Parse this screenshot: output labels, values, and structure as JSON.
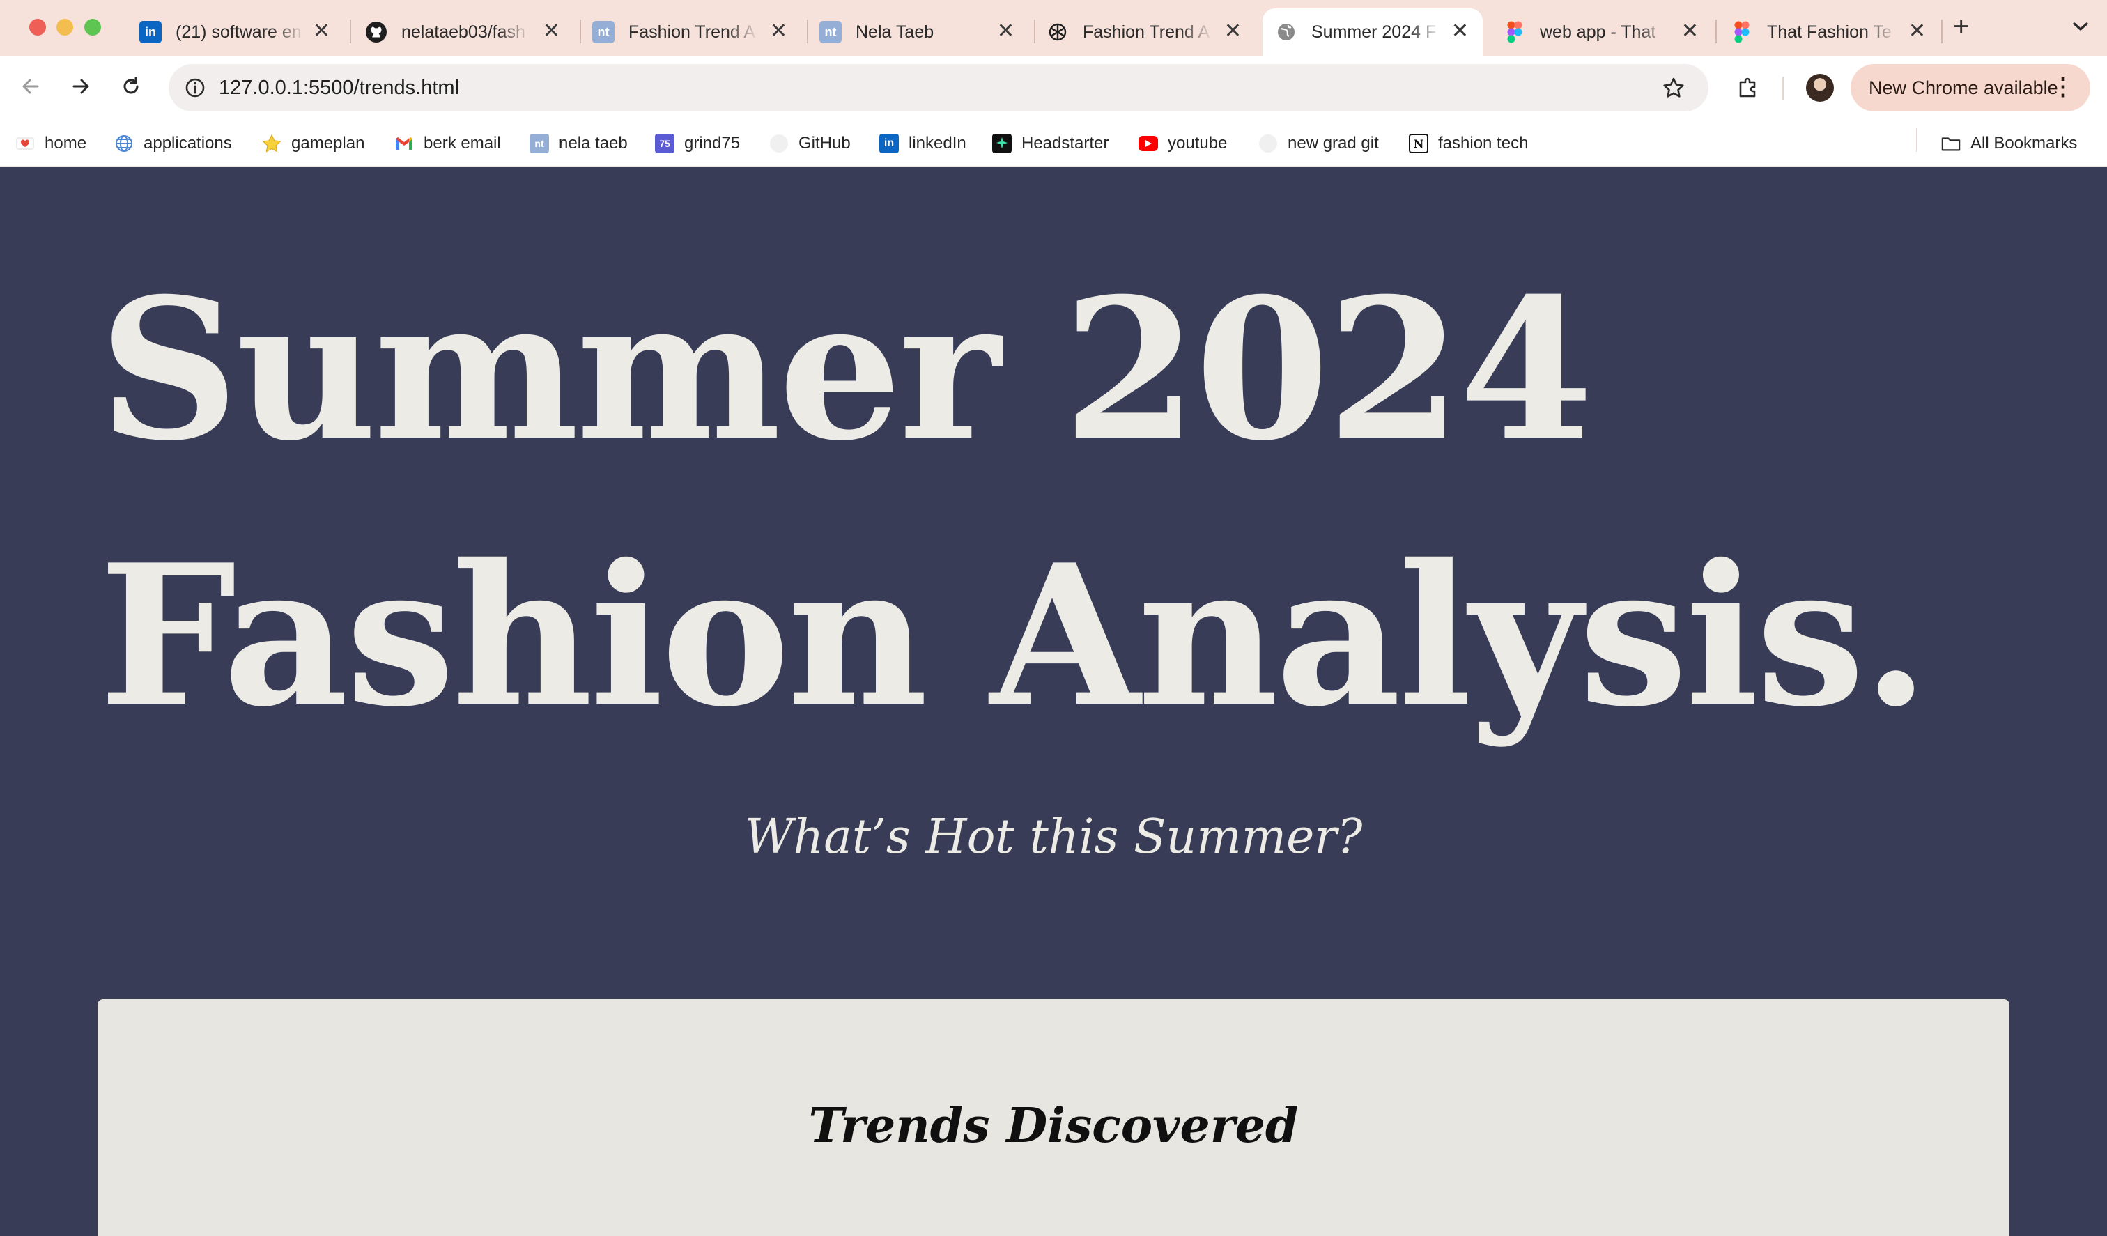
{
  "browser": {
    "tabs": [
      {
        "title": "(21) software en",
        "favicon": "linkedin-icon",
        "active": false
      },
      {
        "title": "nelataeb03/fash",
        "favicon": "github-icon",
        "active": false
      },
      {
        "title": "Fashion Trend A",
        "favicon": "nt-icon",
        "active": false
      },
      {
        "title": "Nela Taeb",
        "favicon": "nt-icon",
        "active": false
      },
      {
        "title": "Fashion Trend A",
        "favicon": "chatgpt-icon",
        "active": false
      },
      {
        "title": "Summer 2024 F",
        "favicon": "globe-icon",
        "active": true
      },
      {
        "title": "web app - That",
        "favicon": "figma-icon",
        "active": false
      },
      {
        "title": "That Fashion Te",
        "favicon": "figma-icon",
        "active": false
      }
    ],
    "favicon_text": {
      "nt": "nt"
    },
    "close_glyph": "✕",
    "new_tab_glyph": "+",
    "url": "127.0.0.1:5500/trends.html",
    "update_label": "New Chrome available",
    "bookmarks": [
      {
        "label": "home",
        "icon": "heart-mail-icon"
      },
      {
        "label": "applications",
        "icon": "globe-icon"
      },
      {
        "label": "gameplan",
        "icon": "star-icon"
      },
      {
        "label": "berk email",
        "icon": "gmail-icon"
      },
      {
        "label": "nela taeb",
        "icon": "nt-icon"
      },
      {
        "label": "grind75",
        "icon": "grind75-icon",
        "icon_text": "75"
      },
      {
        "label": "GitHub",
        "icon": "github-icon"
      },
      {
        "label": "linkedIn",
        "icon": "linkedin-icon"
      },
      {
        "label": "Headstarter",
        "icon": "headstarter-icon"
      },
      {
        "label": "youtube",
        "icon": "youtube-icon"
      },
      {
        "label": "new grad git",
        "icon": "github-icon"
      },
      {
        "label": "fashion tech",
        "icon": "notion-icon"
      }
    ],
    "all_bookmarks_label": "All Bookmarks"
  },
  "page": {
    "hero_line1": "Summer 2024",
    "hero_line2": "Fashion Analysis.",
    "subtitle": "What’s Hot this Summer?",
    "card_title": "Trends Discovered"
  },
  "colors": {
    "page_background": "#383c57",
    "hero_text": "#ecebe5",
    "card_background": "#e8e6e0",
    "tabstrip": "#f6e2db"
  }
}
